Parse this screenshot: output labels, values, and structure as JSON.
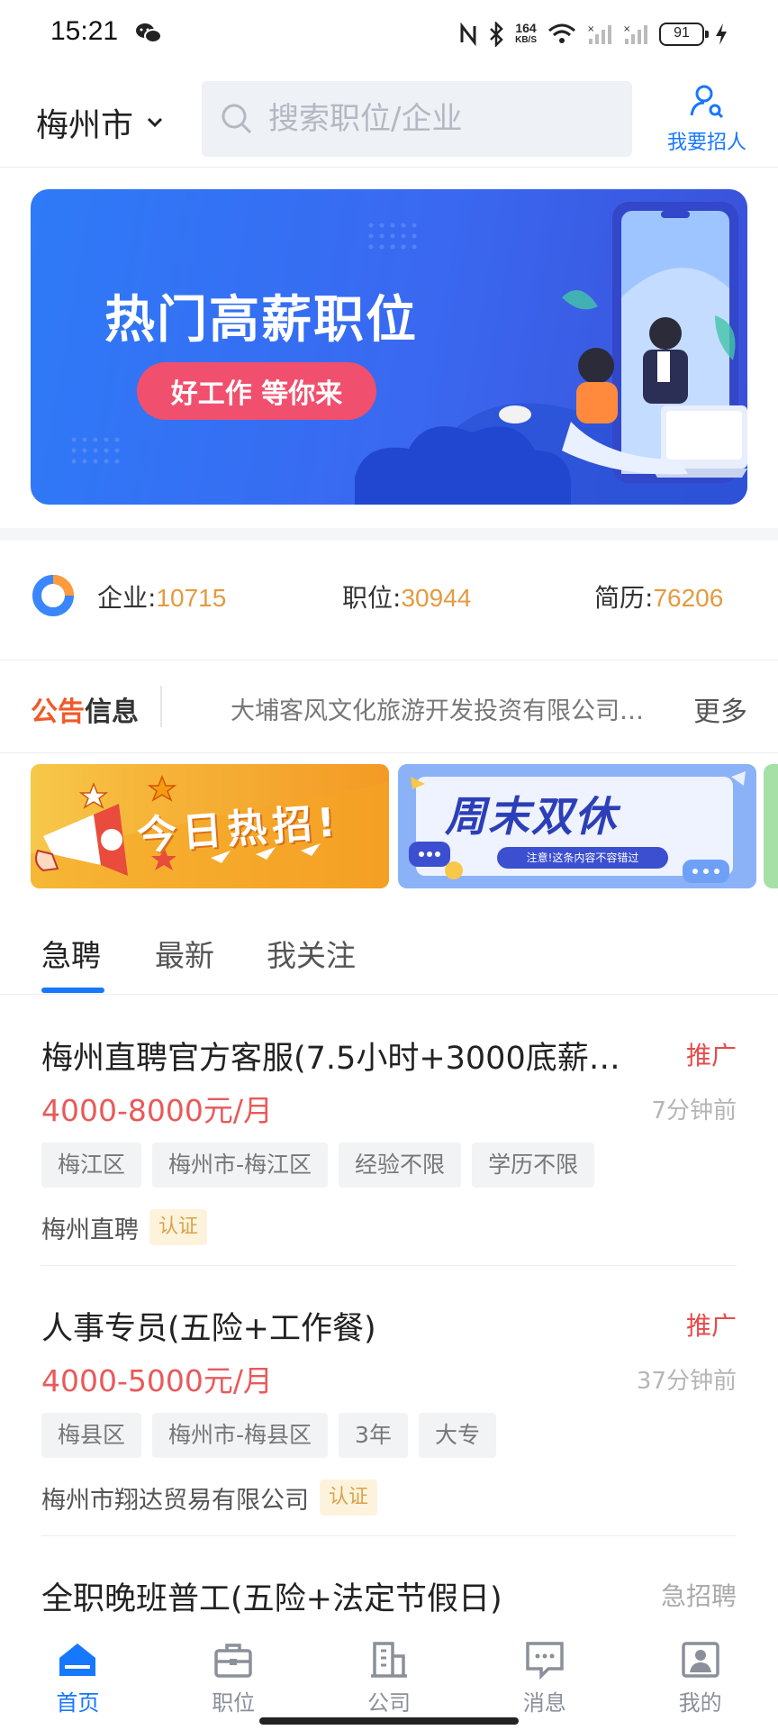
{
  "status_bar": {
    "time": "15:21",
    "net_speed_value": "164",
    "net_speed_unit": "KB/S",
    "battery": "91"
  },
  "header": {
    "city": "梅州市",
    "search_placeholder": "搜索职位/企业",
    "recruit_label": "我要招人"
  },
  "banner": {
    "title": "热门高薪职位",
    "pill": "好工作 等你来"
  },
  "stats": {
    "company_label": "企业:",
    "company_value": "10715",
    "job_label": "职位:",
    "job_value": "30944",
    "resume_label": "简历:",
    "resume_value": "76206"
  },
  "notice": {
    "logo_a": "公告",
    "logo_b": "信息",
    "text": "大埔客风文化旅游开发投资有限公司…",
    "more": "更多"
  },
  "promos": {
    "p1_text": "今日热招!",
    "p2_text": "周末双休",
    "p2_note": "注意!这条内容不容错过"
  },
  "tabs": [
    "急聘",
    "最新",
    "我关注"
  ],
  "jobs": [
    {
      "title": "梅州直聘官方客服(7.5小时+3000底薪…",
      "badge": "推广",
      "salary": "4000-8000元/月",
      "time": "7分钟前",
      "tags": [
        "梅江区",
        "梅州市-梅江区",
        "经验不限",
        "学历不限"
      ],
      "company": "梅州直聘",
      "cert": "认证"
    },
    {
      "title": "人事专员(五险+工作餐)",
      "badge": "推广",
      "salary": "4000-5000元/月",
      "time": "37分钟前",
      "tags": [
        "梅县区",
        "梅州市-梅县区",
        "3年",
        "大专"
      ],
      "company": "梅州市翔达贸易有限公司",
      "cert": "认证"
    },
    {
      "title": "全职晚班普工(五险+法定节假日)",
      "badge": "急招聘"
    }
  ],
  "tabbar": [
    "首页",
    "职位",
    "公司",
    "消息",
    "我的"
  ],
  "colors": {
    "accent": "#1677ff",
    "salary": "#e85a5a",
    "stat_number": "#e59a3f",
    "promo_badge": "#e84a4a"
  }
}
